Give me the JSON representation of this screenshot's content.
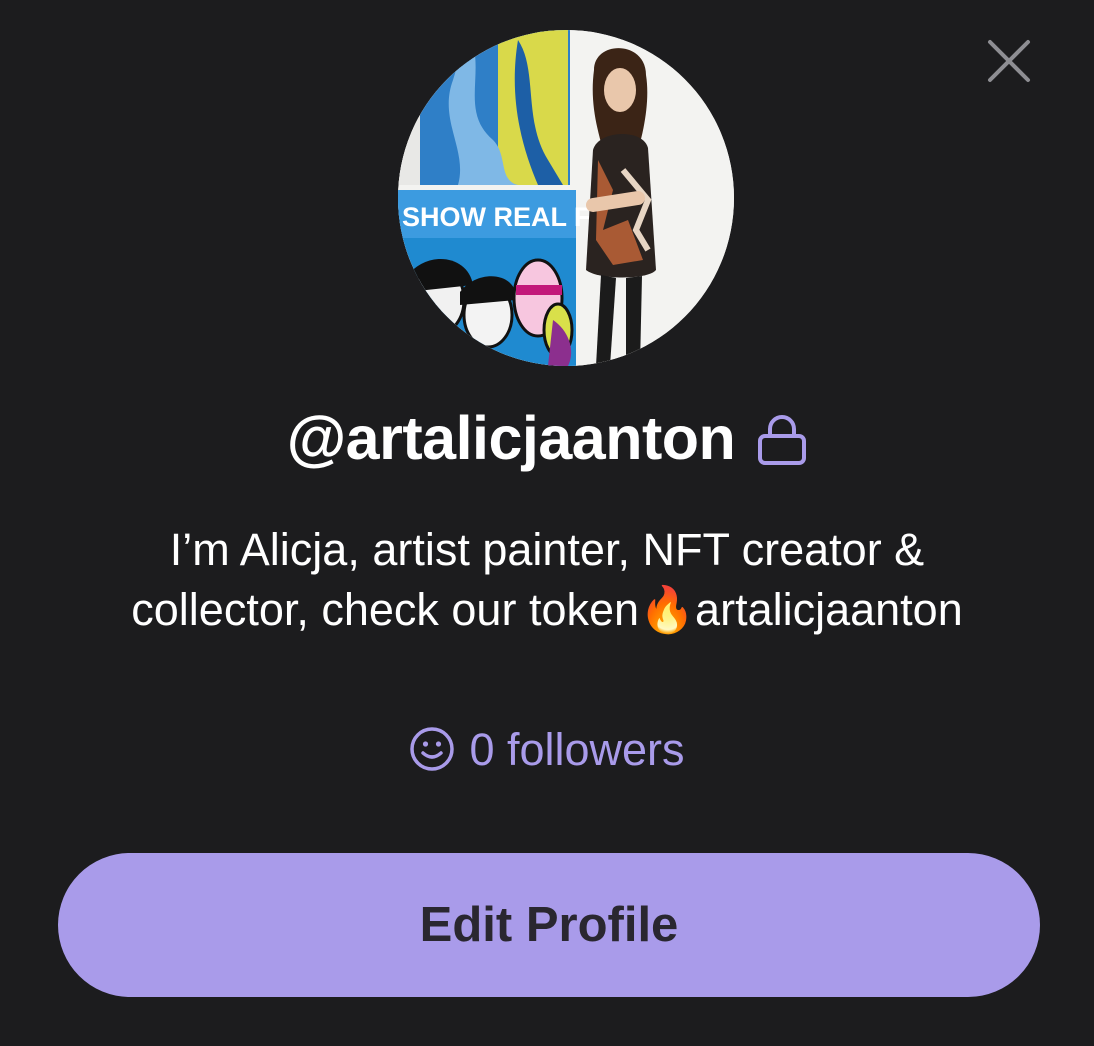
{
  "profile": {
    "username": "@artalicjaanton",
    "bio_line1": "I’m Alicja, artist painter, NFT creator &",
    "bio_line2": "collector, check our token🔥artalicjaanton",
    "avatar_painting_text": "SHOW REAL FACE",
    "followers_label": "0 followers"
  },
  "actions": {
    "edit_profile_label": "Edit Profile"
  },
  "icons": {
    "close": "close-icon",
    "lock": "lock-icon",
    "followers": "smiley-icon"
  },
  "colors": {
    "background": "#1c1c1e",
    "accent": "#a99bea",
    "text": "#ffffff",
    "button_text": "#2a2730",
    "close_icon": "#8e8e93"
  }
}
